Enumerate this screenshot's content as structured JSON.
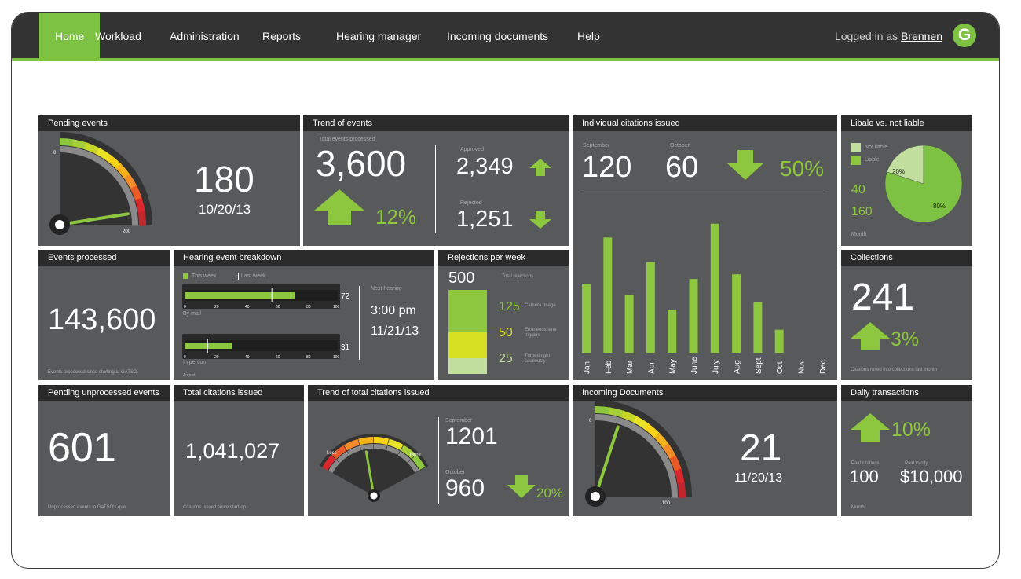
{
  "nav": {
    "items": [
      "Home",
      "Workload",
      "Administration",
      "Reports",
      "Hearing manager",
      "Incoming documents",
      "Help"
    ],
    "logged_in_prefix": "Logged in as",
    "user": "Brennen",
    "logo": "G"
  },
  "colors": {
    "accent": "#7dc242",
    "panel": "#58595b",
    "header": "#2b2b2b"
  },
  "pending_events": {
    "title": "Pending events",
    "value": "180",
    "date": "10/20/13",
    "gauge_min": "0",
    "gauge_max": "200",
    "gauge_level": 0.9
  },
  "trend_events": {
    "title": "Trend of events",
    "total_label": "Total events processed",
    "total": "3,600",
    "change": "12%",
    "approved_label": "Approved",
    "approved": "2,349",
    "rejected_label": "Rejected",
    "rejected": "1,251"
  },
  "citations": {
    "title": "Individual citations issued",
    "m1_label": "September",
    "m1_value": "120",
    "m2_label": "October",
    "m2_value": "60",
    "change": "50%"
  },
  "liable": {
    "title": "Libale vs. not liable",
    "legend_not": "Not liable",
    "legend_liable": "Liable",
    "v1": "40",
    "v2": "160",
    "month_label": "Month",
    "pct_not": "20%",
    "pct_liable": "80%"
  },
  "events_processed": {
    "title": "Events processed",
    "value": "143,600",
    "note": "Events processed since starting at GATSO"
  },
  "hearing": {
    "title": "Hearing event breakdown",
    "legend_week": "This week",
    "legend_last": "Last week",
    "bar1_label": "By mail",
    "bar1_value": "72",
    "bar1_this": 72,
    "bar1_last": 57,
    "bar2_label": "In person",
    "bar2_value": "31",
    "bar2_this": 31,
    "bar2_last": 15,
    "axis": [
      "0",
      "20",
      "40",
      "60",
      "80",
      "100"
    ],
    "month_note": "August",
    "next_label": "Next hearing",
    "next_time": "3:00 pm",
    "next_date": "11/21/13"
  },
  "rejections": {
    "title": "Rejections per week",
    "total": "500",
    "total_label": "Total rejections",
    "items": [
      {
        "value": "125",
        "label": "Camera Image"
      },
      {
        "value": "50",
        "label": "Erroneous lane triggers"
      },
      {
        "value": "25",
        "label": "Turned right cautiously"
      }
    ]
  },
  "collections": {
    "title": "Collections",
    "value": "241",
    "change": "3%",
    "note": "Citations rolled into collections last month"
  },
  "pending_unprocessed": {
    "title": "Pending unprocessed events",
    "value": "601",
    "note": "Unprocessed events in GATSO's que"
  },
  "total_citations": {
    "title": "Total citations issued",
    "value": "1,041,027",
    "note": "Citations issued since start-up"
  },
  "trend_total": {
    "title": "Trend of total citations issued",
    "less": "Less",
    "more": "More",
    "m1_label": "September",
    "m1_value": "1201",
    "m2_label": "October",
    "m2_value": "960",
    "change": "20%",
    "gauge_level": 0.42
  },
  "incoming": {
    "title": "Incoming Documents",
    "value": "21",
    "date": "11/20/13",
    "gauge_min": "0",
    "gauge_max": "100",
    "gauge_level": 0.2
  },
  "daily": {
    "title": "Daily transactions",
    "change": "10%",
    "paid_label": "Paid citations",
    "paid_value": "100",
    "city_label": "Paid to city",
    "city_value": "$10,000",
    "month_label": "Month"
  },
  "chart_data": {
    "type": "bar",
    "title": "Individual citations issued",
    "categories": [
      "Jan",
      "Feb",
      "Mar",
      "Apr",
      "May",
      "June",
      "July",
      "Aug",
      "Sept",
      "Oct",
      "Nov",
      "Dec"
    ],
    "values": [
      90,
      150,
      75,
      118,
      56,
      96,
      168,
      102,
      66,
      30,
      0,
      0
    ],
    "ylim": [
      0,
      180
    ]
  }
}
